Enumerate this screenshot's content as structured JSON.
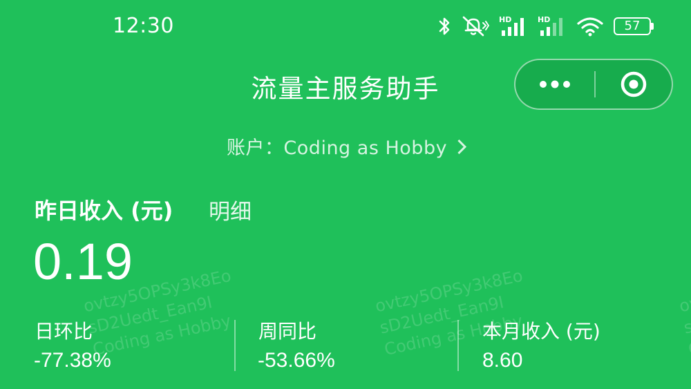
{
  "status_bar": {
    "time": "12:30",
    "network_1": "HD",
    "network_2": "HD",
    "battery": "57"
  },
  "header": {
    "title": "流量主服务助手",
    "account": "账户：Coding as Hobby"
  },
  "income": {
    "label": "昨日收入 (元)",
    "detail_link": "明细",
    "value": "0.19"
  },
  "stats": [
    {
      "label": "日环比",
      "value": "-77.38%"
    },
    {
      "label": "周同比",
      "value": "-53.66%"
    },
    {
      "label": "本月收入 (元)",
      "value": "8.60"
    }
  ],
  "watermark": {
    "line1": "ovtzy5OPSy3k8Eo",
    "line2": "sD2Uedt_Ean9I",
    "line3": "Coding as Hobby"
  },
  "colors": {
    "background": "#1fc05a",
    "text": "#ffffff"
  }
}
